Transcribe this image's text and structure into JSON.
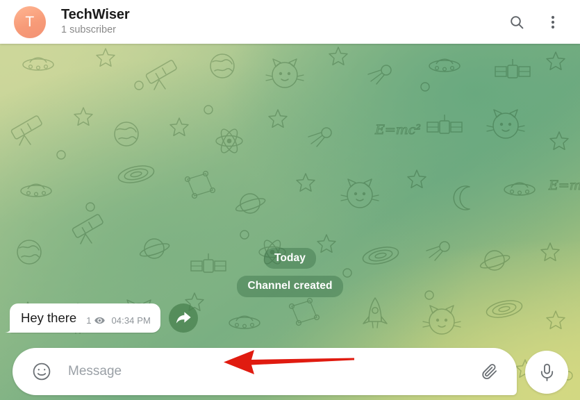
{
  "header": {
    "avatar_letter": "T",
    "avatar_color": "#f79b78",
    "title": "TechWiser",
    "subtitle": "1 subscriber",
    "search_icon": "search-icon",
    "menu_icon": "more-vertical-icon"
  },
  "chat": {
    "background_colors": {
      "green": "#72ab80",
      "yellow_green": "#cfd684",
      "pale": "#ccd79b"
    },
    "service_messages": [
      {
        "label": "Today"
      },
      {
        "label": "Channel created"
      }
    ],
    "messages": [
      {
        "text": "Hey there",
        "views": "1",
        "views_icon": "eye-icon",
        "time": "04:34 PM",
        "forward_icon": "forward-arrow-icon"
      }
    ],
    "annotation": {
      "type": "red-arrow",
      "color": "#e01b10",
      "direction": "left"
    }
  },
  "composer": {
    "emoji_icon": "smiley-icon",
    "placeholder": "Message",
    "value": "",
    "attach_icon": "paperclip-icon",
    "mic_icon": "microphone-icon"
  }
}
